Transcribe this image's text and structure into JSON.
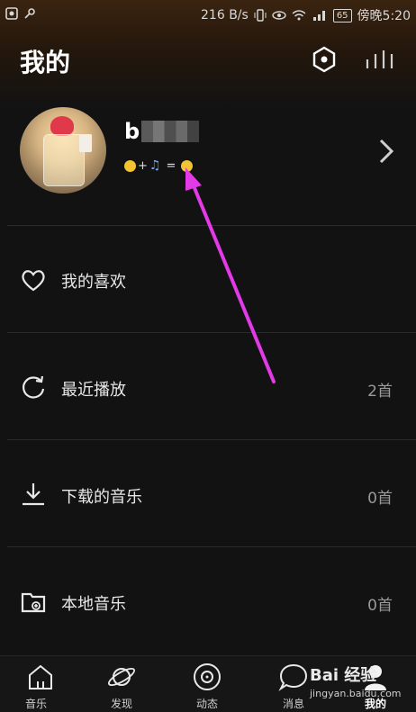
{
  "statusbar": {
    "net_speed": "216 B/s",
    "battery": "65",
    "time": "傍晚5:20",
    "icons": [
      "screenshot-icon",
      "key-icon",
      "vibrate-icon",
      "eye-icon",
      "wifi-icon",
      "signal-icon",
      "battery-icon"
    ]
  },
  "header": {
    "title": "我的",
    "icons": [
      "settings-hex-icon",
      "equalizer-bars-icon"
    ]
  },
  "profile": {
    "username": "b",
    "signature_plus": "+",
    "signature_eq": "="
  },
  "menu": [
    {
      "label": "我的喜欢",
      "count": "",
      "icon": "heart-icon"
    },
    {
      "label": "最近播放",
      "count": "2首",
      "icon": "refresh-icon"
    },
    {
      "label": "下载的音乐",
      "count": "0首",
      "icon": "download-icon"
    },
    {
      "label": "本地音乐",
      "count": "0首",
      "icon": "local-folder-icon"
    }
  ],
  "nav": [
    {
      "label": "音乐",
      "icon": "home-icon"
    },
    {
      "label": "发现",
      "icon": "planet-icon"
    },
    {
      "label": "动态",
      "icon": "disc-icon"
    },
    {
      "label": "消息",
      "icon": "chat-icon"
    },
    {
      "label": "我的",
      "icon": "user-icon",
      "active": true
    }
  ],
  "watermark": {
    "text": "Bai 经验",
    "url": "jingyan.baidu.com"
  },
  "colors": {
    "background": "#121212",
    "header_gradient": "#3a2410",
    "annotation_arrow": "#e23ae6"
  }
}
